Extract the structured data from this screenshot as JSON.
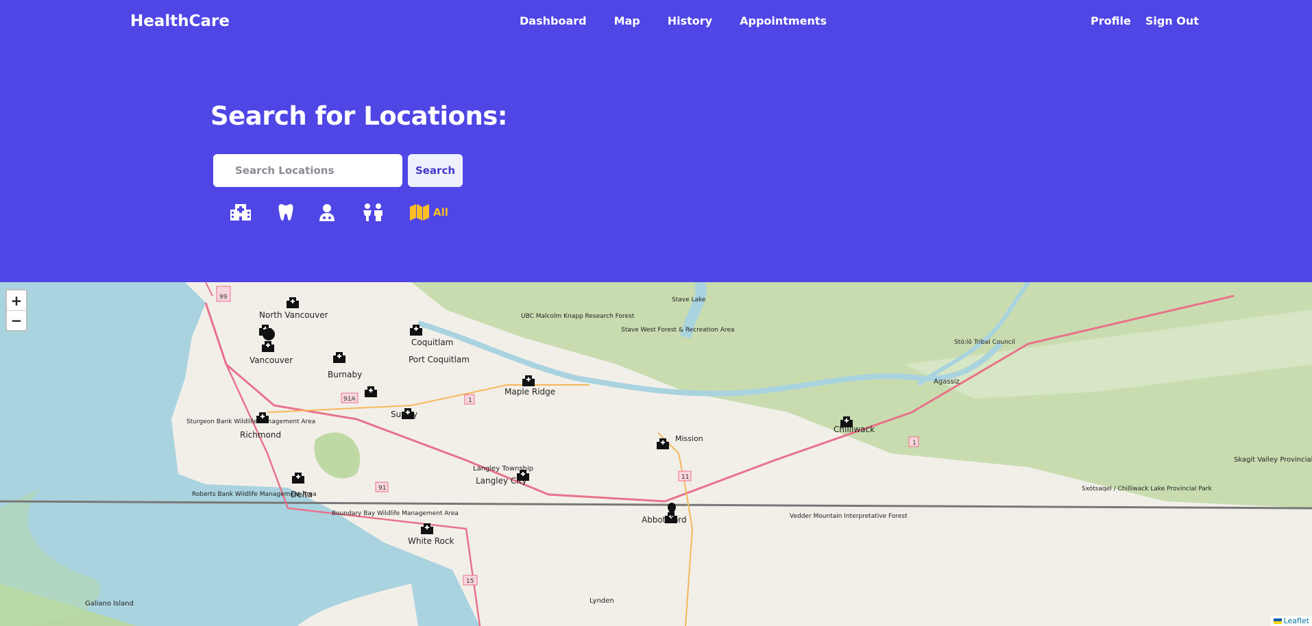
{
  "app": {
    "brand": "HealthCare"
  },
  "nav": {
    "items": [
      "Dashboard",
      "Map",
      "History",
      "Appointments"
    ]
  },
  "user_nav": {
    "profile": "Profile",
    "sign_out": "Sign Out"
  },
  "search": {
    "title": "Search for Locations:",
    "placeholder": "Search Locations",
    "button": "Search"
  },
  "filters": [
    {
      "icon": "hospital-icon",
      "label": ""
    },
    {
      "icon": "tooth-icon",
      "label": ""
    },
    {
      "icon": "doctor-icon",
      "label": ""
    },
    {
      "icon": "family-icon",
      "label": ""
    },
    {
      "icon": "map-icon",
      "label": "All",
      "active": true
    }
  ],
  "colors": {
    "header_bg": "#4f46e5",
    "active_filter": "#fbbf24",
    "water": "#a9d3df",
    "land": "#f2efe9",
    "forest": "#c8dcb0"
  },
  "map": {
    "zoom_in": "+",
    "zoom_out": "−",
    "attribution": "Leaflet",
    "places": {
      "north_vancouver": "North Vancouver",
      "vancouver": "Vancouver",
      "burnaby": "Burnaby",
      "coquitlam": "Coquitlam",
      "port_coquitlam": "Port Coquitlam",
      "maple_ridge": "Maple Ridge",
      "richmond": "Richmond",
      "surrey": "Surrey",
      "delta": "Delta",
      "langley_township": "Langley Township",
      "langley_city": "Langley City",
      "white_rock": "White Rock",
      "mission": "Mission",
      "abbotsford": "Abbotsford",
      "chilliwack": "Chilliwack",
      "agassiz": "Agassiz",
      "lynden": "Lynden",
      "galiano_island": "Galiano Island",
      "stave_lake": "Stave Lake",
      "ubc_forest": "UBC Malcolm Knapp Research Forest",
      "stave_west": "Stave West Forest & Recreation Area",
      "sturgeon_bank": "Sturgeon Bank Wildlife Management Area",
      "roberts_bank": "Roberts Bank Wildlife Management Area",
      "boundary_bay": "Boundary Bay Wildlife Management Area",
      "vedder": "Vedder Mountain Interpretative Forest",
      "skagit": "Skagit Valley Provincial Park",
      "chilliwack_lake": "Sxótsaqel / Chilliwack Lake Provincial Park",
      "sto_lo": "Stó:lō Tribal Council"
    },
    "highways": [
      "99",
      "91A",
      "91",
      "1",
      "11",
      "15",
      "1"
    ]
  }
}
